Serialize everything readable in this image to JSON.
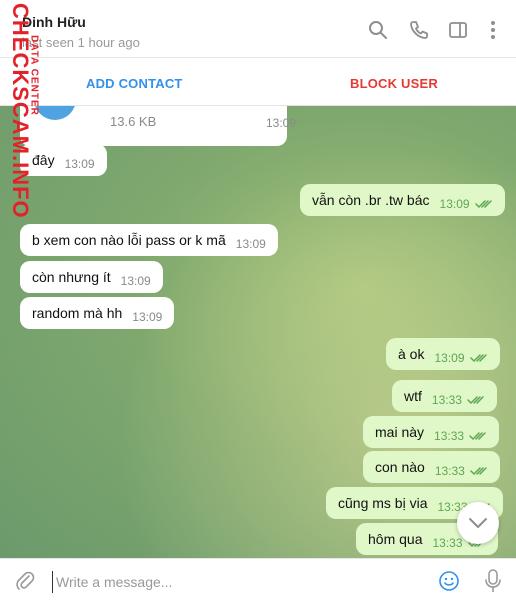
{
  "header": {
    "contact_name": "Đinh Hữu",
    "status": "last seen 1 hour ago"
  },
  "actions": {
    "add_contact": "ADD CONTACT",
    "block_user": "BLOCK USER"
  },
  "file_message": {
    "size": "13.6 KB",
    "time": "13:09"
  },
  "messages": [
    {
      "text": "đây",
      "time": "13:09",
      "direction": "in"
    },
    {
      "text": "vẫn còn .br .tw bác",
      "time": "13:09",
      "direction": "out"
    },
    {
      "text": "b xem con nào lỗi pass or k mã",
      "time": "13:09",
      "direction": "in"
    },
    {
      "text": "còn nhưng ít",
      "time": "13:09",
      "direction": "in"
    },
    {
      "text": "random mà hh",
      "time": "13:09",
      "direction": "in"
    },
    {
      "text": "à ok",
      "time": "13:09",
      "direction": "out"
    },
    {
      "text": "wtf",
      "time": "13:33",
      "direction": "out"
    },
    {
      "text": "mai này",
      "time": "13:33",
      "direction": "out"
    },
    {
      "text": "con nào",
      "time": "13:33",
      "direction": "out"
    },
    {
      "text": "cũng ms bị via",
      "time": "13:33",
      "direction": "out"
    },
    {
      "text": "hôm qua",
      "time": "13:33",
      "direction": "out"
    }
  ],
  "composer": {
    "placeholder": "Write a message..."
  },
  "watermark": {
    "main": "CHECKSCAM.INFO",
    "sub": "DATA CENTER"
  },
  "colors": {
    "accent": "#3390ec",
    "danger": "#e53935",
    "outgoing_bubble": "#e0f7c8",
    "read_tick": "#5fa653"
  },
  "icons": {
    "search": "search-icon",
    "call": "phone-icon",
    "sidebar": "sidebar-toggle-icon",
    "more": "more-vertical-icon",
    "attach": "paperclip-icon",
    "emoji": "emoji-icon",
    "mic": "microphone-icon",
    "scroll": "chevron-down-icon"
  }
}
